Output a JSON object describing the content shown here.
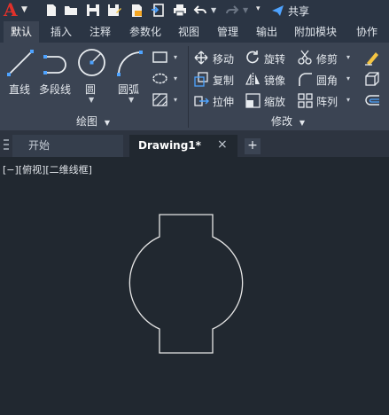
{
  "qat": {
    "share_label": "共享",
    "icons": [
      "new-file-icon",
      "open-folder-icon",
      "save-icon",
      "save-as-icon",
      "plot-preview-icon",
      "import-icon",
      "export-icon",
      "print-icon",
      "undo-icon",
      "redo-icon",
      "customize-icon",
      "share-icon"
    ]
  },
  "ribbon_tabs": [
    "默认",
    "插入",
    "注释",
    "参数化",
    "视图",
    "管理",
    "输出",
    "附加模块",
    "协作"
  ],
  "draw_panel": {
    "tools": [
      "直线",
      "多段线",
      "圆",
      "圆弧"
    ],
    "group_label": "绘图"
  },
  "modify_panel": {
    "rows": [
      [
        "移动",
        "旋转",
        "修剪"
      ],
      [
        "复制",
        "镜像",
        "圆角"
      ],
      [
        "拉伸",
        "缩放",
        "阵列"
      ]
    ],
    "group_label": "修改"
  },
  "doc_tabs": {
    "start": "开始",
    "drawing": "Drawing1*"
  },
  "viewport_label": "[−][俯视][二维线框]",
  "colors": {
    "canvas": "#212830",
    "ribbon": "#3b4453",
    "accent_blue": "#4ea3ff",
    "logo_red": "#e0312b"
  }
}
